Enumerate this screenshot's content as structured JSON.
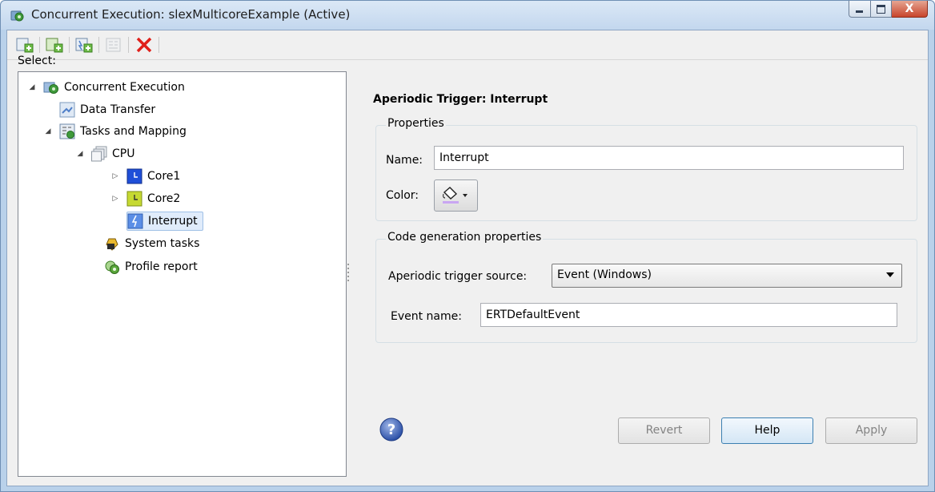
{
  "window": {
    "title": "Concurrent Execution: slexMulticoreExample (Active)",
    "close_glyph": "X"
  },
  "toolbar": {
    "buttons": [
      "add-task-icon",
      "add-periodic-trigger-icon",
      "add-aperiodic-trigger-icon",
      "add-mapping-icon-disabled",
      "delete-icon"
    ]
  },
  "left": {
    "select_label": "Select:",
    "tree": [
      {
        "label": "Concurrent Execution",
        "icon": "concurrent-execution-icon",
        "expanded": true
      },
      {
        "label": "Data Transfer",
        "icon": "data-transfer-icon"
      },
      {
        "label": "Tasks and Mapping",
        "icon": "tasks-mapping-icon",
        "expanded": true
      },
      {
        "label": "CPU",
        "icon": "cpu-icon",
        "expanded": true
      },
      {
        "label": "Core1",
        "icon": "core1-icon",
        "expanded": false
      },
      {
        "label": "Core2",
        "icon": "core2-icon",
        "expanded": false
      },
      {
        "label": "Interrupt",
        "icon": "interrupt-icon",
        "selected": true
      },
      {
        "label": "System tasks",
        "icon": "system-tasks-icon"
      },
      {
        "label": "Profile report",
        "icon": "profile-report-icon"
      }
    ]
  },
  "right": {
    "header": "Aperiodic Trigger: Interrupt",
    "properties": {
      "title": "Properties",
      "name_label": "Name:",
      "name_value": "Interrupt",
      "color_label": "Color:"
    },
    "codegen": {
      "title": "Code generation properties",
      "source_label": "Aperiodic trigger source:",
      "source_value": "Event (Windows)",
      "event_label": "Event name:",
      "event_value": "ERTDefaultEvent"
    },
    "buttons": {
      "revert": "Revert",
      "help": "Help",
      "apply": "Apply"
    }
  },
  "colors": {
    "core1": "#1f4fd8",
    "core2": "#c6d932",
    "interrupt": "#5b8ee6",
    "delete": "#e0201b",
    "add": "#5aa63a"
  }
}
